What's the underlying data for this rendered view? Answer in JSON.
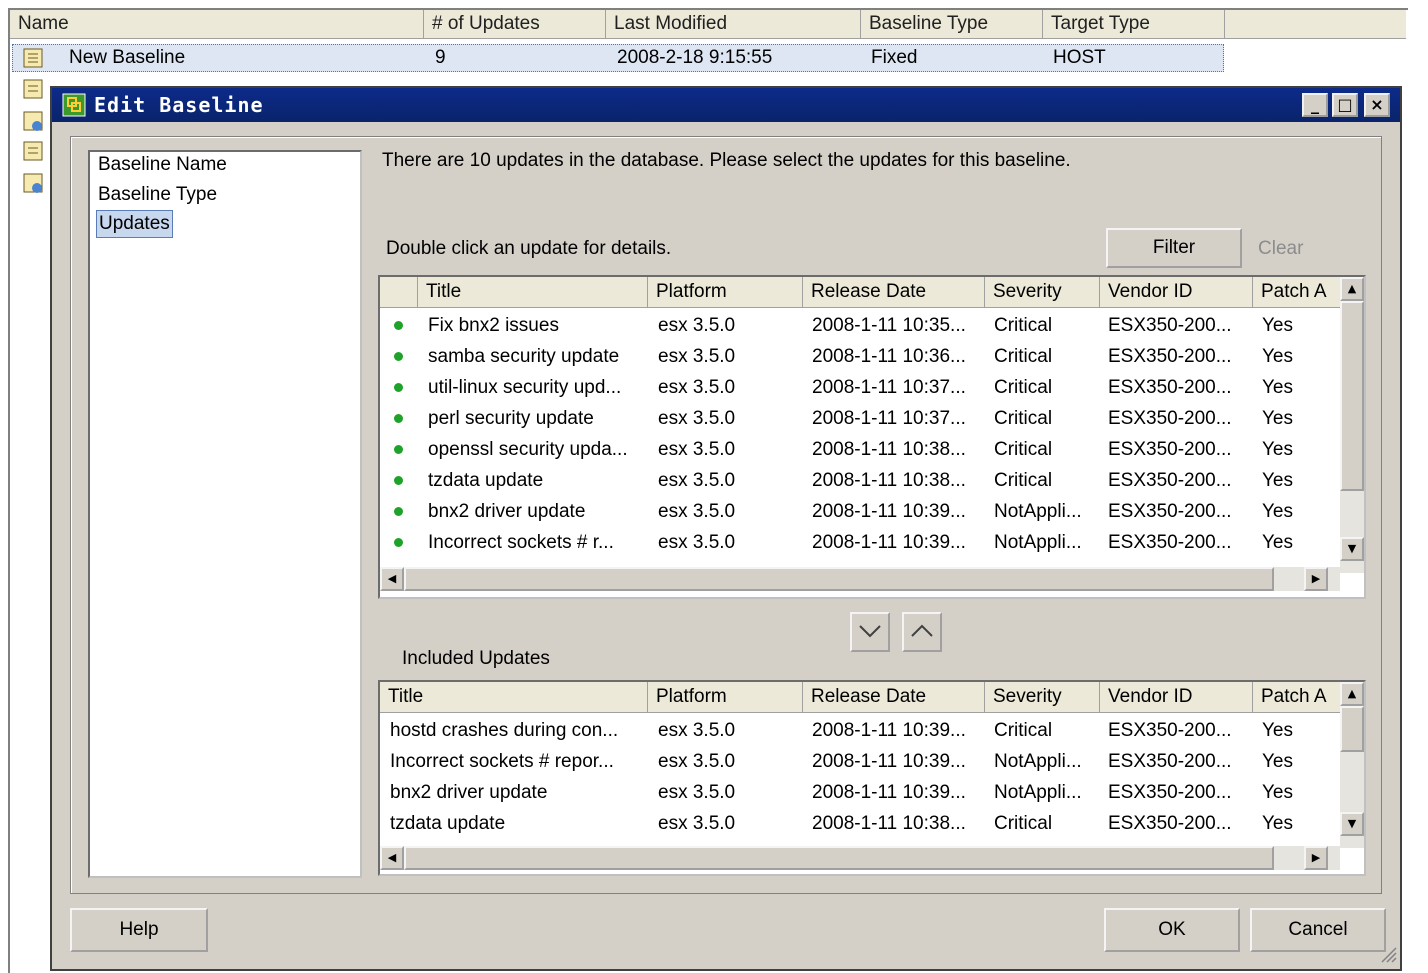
{
  "background_list": {
    "columns": [
      "Name",
      "# of Updates",
      "Last Modified",
      "Baseline Type",
      "Target Type"
    ],
    "row": {
      "name": "New Baseline",
      "updates": "9",
      "modified": "2008-2-18 9:15:55",
      "baseline_type": "Fixed",
      "target_type": "HOST"
    }
  },
  "dialog": {
    "title": "Edit Baseline",
    "nav": [
      "Baseline Name",
      "Baseline Type",
      "Updates"
    ],
    "selected_nav": "Updates",
    "info_text": "There are 10 updates in the database. Please select the updates for this baseline.",
    "hint_text": "Double click an update for details.",
    "filter_label": "Filter",
    "clear_label": "Clear",
    "available": {
      "columns": [
        "Title",
        "Platform",
        "Release Date",
        "Severity",
        "Vendor ID",
        "Patch A"
      ],
      "rows": [
        {
          "title": "Fix bnx2 issues",
          "platform": "esx 3.5.0",
          "date": "2008-1-11 10:35...",
          "severity": "Critical",
          "vendor": "ESX350-200...",
          "patch": "Yes"
        },
        {
          "title": "samba security update",
          "platform": "esx 3.5.0",
          "date": "2008-1-11 10:36...",
          "severity": "Critical",
          "vendor": "ESX350-200...",
          "patch": "Yes"
        },
        {
          "title": "util-linux security upd...",
          "platform": "esx 3.5.0",
          "date": "2008-1-11 10:37...",
          "severity": "Critical",
          "vendor": "ESX350-200...",
          "patch": "Yes"
        },
        {
          "title": "perl security update",
          "platform": "esx 3.5.0",
          "date": "2008-1-11 10:37...",
          "severity": "Critical",
          "vendor": "ESX350-200...",
          "patch": "Yes"
        },
        {
          "title": "openssl security upda...",
          "platform": "esx 3.5.0",
          "date": "2008-1-11 10:38...",
          "severity": "Critical",
          "vendor": "ESX350-200...",
          "patch": "Yes"
        },
        {
          "title": "tzdata update",
          "platform": "esx 3.5.0",
          "date": "2008-1-11 10:38...",
          "severity": "Critical",
          "vendor": "ESX350-200...",
          "patch": "Yes"
        },
        {
          "title": "bnx2 driver update",
          "platform": "esx 3.5.0",
          "date": "2008-1-11 10:39...",
          "severity": "NotAppli...",
          "vendor": "ESX350-200...",
          "patch": "Yes"
        },
        {
          "title": "Incorrect sockets # r...",
          "platform": "esx 3.5.0",
          "date": "2008-1-11 10:39...",
          "severity": "NotAppli...",
          "vendor": "ESX350-200...",
          "patch": "Yes"
        }
      ]
    },
    "included_label": "Included Updates",
    "included": {
      "columns": [
        "Title",
        "Platform",
        "Release Date",
        "Severity",
        "Vendor ID",
        "Patch A"
      ],
      "rows": [
        {
          "title": "hostd crashes during con...",
          "platform": "esx 3.5.0",
          "date": "2008-1-11 10:39...",
          "severity": "Critical",
          "vendor": "ESX350-200...",
          "patch": "Yes"
        },
        {
          "title": "Incorrect sockets # repor...",
          "platform": "esx 3.5.0",
          "date": "2008-1-11 10:39...",
          "severity": "NotAppli...",
          "vendor": "ESX350-200...",
          "patch": "Yes"
        },
        {
          "title": "bnx2 driver update",
          "platform": "esx 3.5.0",
          "date": "2008-1-11 10:39...",
          "severity": "NotAppli...",
          "vendor": "ESX350-200...",
          "patch": "Yes"
        },
        {
          "title": "tzdata update",
          "platform": "esx 3.5.0",
          "date": "2008-1-11 10:38...",
          "severity": "Critical",
          "vendor": "ESX350-200...",
          "patch": "Yes"
        }
      ]
    },
    "help_label": "Help",
    "ok_label": "OK",
    "cancel_label": "Cancel",
    "icons": [
      "baseline-icon",
      "vmware-logo-icon",
      "minimize-icon",
      "maximize-icon",
      "close-icon",
      "move-down-icon",
      "move-up-icon",
      "resize-grip-icon"
    ],
    "colors": {
      "titlebar": "#0a246a",
      "dialog_bg": "#d4d0c8",
      "status_dot": "#1fa22a",
      "selection": "#c7d7ee"
    }
  }
}
